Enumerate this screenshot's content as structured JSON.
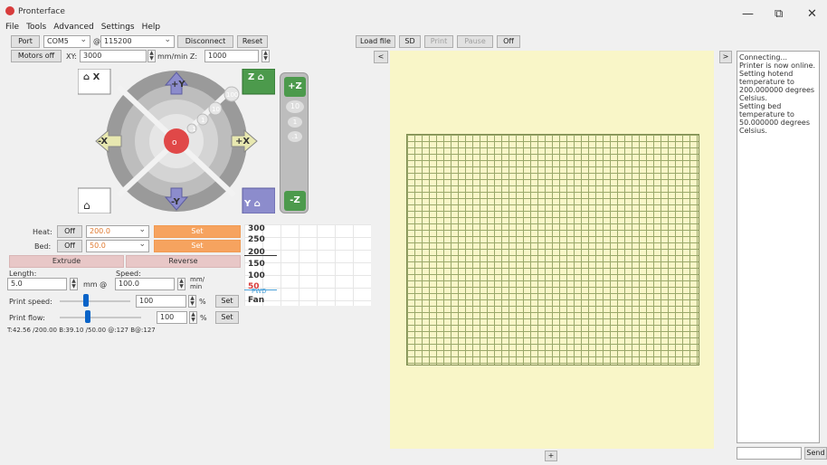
{
  "window": {
    "title": "Pronterface",
    "minimize": "—",
    "restore": "⧉",
    "close": "✕"
  },
  "menu": [
    "File",
    "Tools",
    "Advanced",
    "Settings",
    "Help"
  ],
  "toolbar": {
    "port_label": "Port",
    "port_value": "COM5",
    "at": "@",
    "baud_value": "115200",
    "disconnect": "Disconnect",
    "reset": "Reset",
    "load_file": "Load file",
    "sd": "SD",
    "print": "Print",
    "pause": "Pause",
    "off": "Off"
  },
  "motors": {
    "motors_off": "Motors off",
    "xy_label": "XY:",
    "xy_value": "3000",
    "mm_min_z": "mm/min Z:",
    "z_value": "1000"
  },
  "jog": {
    "home_x": "X",
    "home_z": "Z",
    "plus_y": "+Y",
    "minus_y": "-Y",
    "plus_x": "+X",
    "minus_x": "-X",
    "plus_z": "+Z",
    "minus_z": "-Z",
    "home_y": "Y",
    "steps": [
      "100",
      "10",
      "1",
      ".1"
    ],
    "z_steps": [
      "10",
      "1",
      ".1"
    ]
  },
  "temps": {
    "heat_label": "Heat:",
    "bed_label": "Bed:",
    "off": "Off",
    "heat_value": "200.0",
    "bed_value": "50.0",
    "set": "Set",
    "extrude": "Extrude",
    "reverse": "Reverse",
    "length_label": "Length:",
    "speed_label": "Speed:",
    "length_value": "5.0",
    "mm_at": "mm @",
    "speed_value": "100.0",
    "mm_min": "mm/\nmin",
    "print_speed_label": "Print speed:",
    "print_speed_value": "100",
    "percent": "%",
    "print_flow_label": "Print flow:",
    "print_flow_value": "100",
    "status": "T:42.56 /200.00 B:39.10 /50.00 @:127 B@:127"
  },
  "graph": {
    "ticks": [
      "300",
      "250",
      "200",
      "150",
      "100",
      "50"
    ],
    "legend": [
      "PWD",
      "Fan"
    ]
  },
  "viewer": {
    "left_arrow": "<",
    "plus": "+"
  },
  "console": {
    "toggle": ">",
    "log": "Connecting...\nPrinter is now online.\nSetting hotend temperature to 200.000000 degrees Celsius.\nSetting bed temperature to 50.000000 degrees Celsius.",
    "send": "Send"
  },
  "colors": {
    "viewer_bg": "#f9f6c8",
    "grid_line": "#9aa86a",
    "orange": "#f6a35f",
    "jog_green": "#4c9a4c",
    "jog_blue": "#8c8ccc"
  }
}
